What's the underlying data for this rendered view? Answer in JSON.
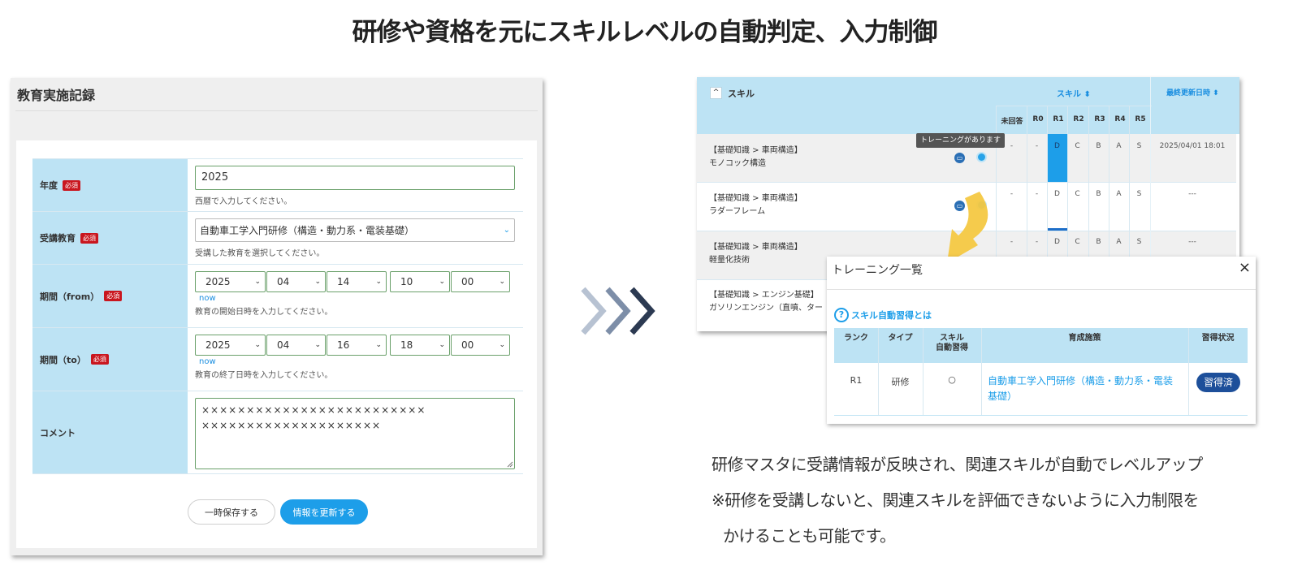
{
  "title": "研修や資格を元にスキルレベルの自動判定、入力制御",
  "form": {
    "title": "教育実施記録",
    "required_badge": "必須",
    "year": {
      "label": "年度",
      "value": "2025",
      "help": "西暦で入力してください。"
    },
    "course": {
      "label": "受講教育",
      "value": "自動車工学入門研修（構造・動力系・電装基礎）",
      "help": "受講した教育を選択してください。"
    },
    "from": {
      "label": "期間（from）",
      "year": "2025",
      "month": "04",
      "day": "14",
      "hour": "10",
      "minute": "00",
      "now": "now",
      "help": "教育の開始日時を入力してください。"
    },
    "to": {
      "label": "期間（to）",
      "year": "2025",
      "month": "04",
      "day": "16",
      "hour": "18",
      "minute": "00",
      "now": "now",
      "help": "教育の終了日時を入力してください。"
    },
    "comment": {
      "label": "コメント",
      "line1": "×××××××××××××××××××××××××",
      "line2": "××××××××××××××××××××"
    },
    "save_label": "一時保存する",
    "update_label": "情報を更新する"
  },
  "skills": {
    "title": "スキル",
    "sort_skill": "スキル ⬍",
    "sort_updated": "最終更新日時 ⬍",
    "levels": [
      "未回答",
      "R0",
      "R1",
      "R2",
      "R3",
      "R4",
      "R5"
    ],
    "tooltip": "トレーニングがあります",
    "rows": [
      {
        "category": "【基礎知識 > 車両構造】",
        "name": "モノコック構造",
        "values": [
          "-",
          "-",
          "D",
          "C",
          "B",
          "A",
          "S"
        ],
        "updated": "2025/04/01 18:01"
      },
      {
        "category": "【基礎知識 > 車両構造】",
        "name": "ラダーフレーム",
        "values": [
          "-",
          "-",
          "D",
          "C",
          "B",
          "A",
          "S"
        ],
        "updated": "---"
      },
      {
        "category": "【基礎知識 > 車両構造】",
        "name": "軽量化技術",
        "values": [
          "-",
          "-",
          "D",
          "C",
          "B",
          "A",
          "S"
        ],
        "updated": "---"
      },
      {
        "category": "【基礎知識 > エンジン基礎】",
        "name": "ガソリンエンジン（直噴、ター"
      }
    ]
  },
  "modal": {
    "title": "トレーニング一覧",
    "close": "×",
    "help_link": "スキル自動習得とは",
    "headers": {
      "rank": "ランク",
      "type": "タイプ",
      "auto1": "スキル",
      "auto2": "自動習得",
      "measure": "育成施策",
      "status": "習得状況"
    },
    "row": {
      "rank": "R1",
      "type": "研修",
      "auto": "○",
      "measure": "自動車工学入門研修（構造・動力系・電装基礎）",
      "status": "習得済"
    }
  },
  "captions": [
    "研修マスタに受講情報が反映され、関連スキルが自動でレベルアップ",
    "※研修を受講しないと、関連スキルを評価できないように入力制限を",
    "かけることも可能です。"
  ],
  "colors": {
    "accent": "#1d9ee9",
    "header_bg": "#bde3f4",
    "required": "#c9161e",
    "arrow": "#f4c842"
  }
}
